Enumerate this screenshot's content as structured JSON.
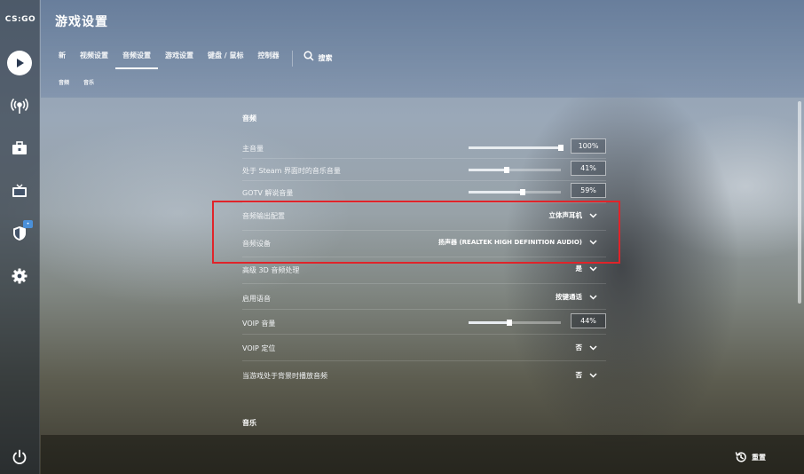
{
  "app": {
    "logo_text": "CS:GO"
  },
  "sidebar": {
    "items": [
      {
        "icon": "play-icon"
      },
      {
        "icon": "broadcast-icon"
      },
      {
        "icon": "inventory-briefcase-icon"
      },
      {
        "icon": "tv-icon"
      },
      {
        "icon": "shield-icon",
        "badge": "•"
      },
      {
        "icon": "gear-icon"
      }
    ],
    "power_icon": "power-icon"
  },
  "header": {
    "title": "游戏设置",
    "tabs": [
      {
        "label": "新"
      },
      {
        "label": "视频设置"
      },
      {
        "label": "音频设置",
        "active": true
      },
      {
        "label": "游戏设置"
      },
      {
        "label": "键盘 / 鼠标"
      },
      {
        "label": "控制器"
      }
    ],
    "search_label": "搜索",
    "subtabs": [
      "音频",
      "音乐"
    ]
  },
  "sections": {
    "audio_heading": "音频",
    "music_heading": "音乐"
  },
  "rows": {
    "master_volume": {
      "label": "主音量",
      "value": "100%",
      "level": 1.0
    },
    "steam_music_volume": {
      "label": "处于 Steam 界面时的音乐音量",
      "value": "41%",
      "level": 0.41
    },
    "gotv_volume": {
      "label": "GOTV 解说音量",
      "value": "59%",
      "level": 0.59
    },
    "audio_output": {
      "label": "音频输出配置",
      "value": "立体声耳机"
    },
    "audio_device": {
      "label": "音频设备",
      "value": "扬声器 (REALTEK HIGH DEFINITION AUDIO)"
    },
    "advanced_3d": {
      "label": "高级 3D 音频处理",
      "value": "是"
    },
    "enable_voice": {
      "label": "启用语音",
      "value": "按键通话"
    },
    "voip_volume": {
      "label": "VOIP 音量",
      "value": "44%",
      "level": 0.44
    },
    "voip_positional": {
      "label": "VOIP 定位",
      "value": "否"
    },
    "play_in_background": {
      "label": "当游戏处于背景时播放音频",
      "value": "否"
    }
  },
  "footer": {
    "reset_label": "重置"
  },
  "colors": {
    "highlight": "#e0242a",
    "accent": "#4a90d9"
  }
}
